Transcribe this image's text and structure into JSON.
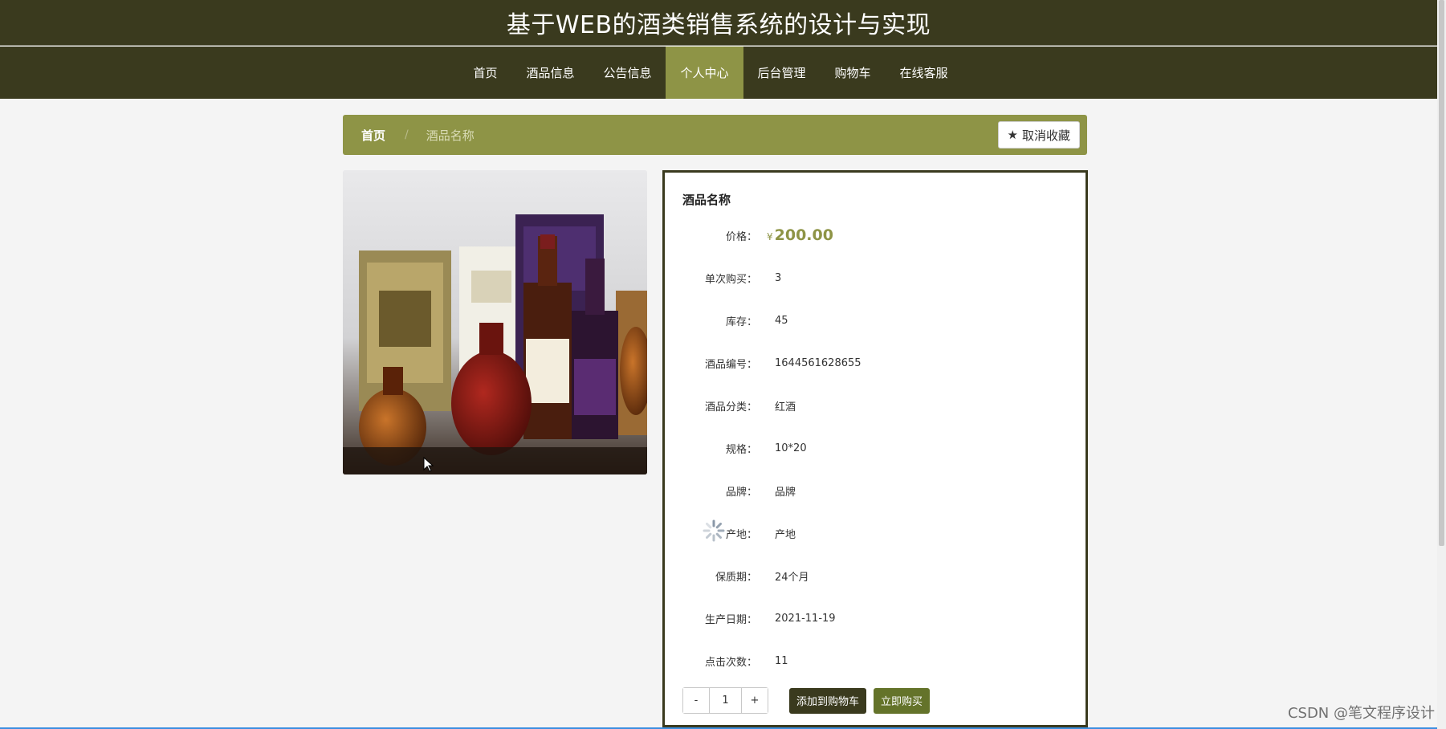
{
  "header": {
    "title": "基于WEB的酒类销售系统的设计与实现"
  },
  "nav": {
    "items": [
      {
        "label": "首页",
        "active": false
      },
      {
        "label": "酒品信息",
        "active": false
      },
      {
        "label": "公告信息",
        "active": false
      },
      {
        "label": "个人中心",
        "active": true
      },
      {
        "label": "后台管理",
        "active": false
      },
      {
        "label": "购物车",
        "active": false
      },
      {
        "label": "在线客服",
        "active": false
      }
    ]
  },
  "breadcrumb": {
    "home": "首页",
    "separator": "/",
    "current": "酒品名称"
  },
  "favorite_button": {
    "icon": "star-icon",
    "label": "取消收藏"
  },
  "product": {
    "name": "酒品名称",
    "price_label": "价格：",
    "currency": "¥",
    "price": "200.00",
    "fields": [
      {
        "label": "单次购买：",
        "value": "3"
      },
      {
        "label": "库存：",
        "value": "45"
      },
      {
        "label": "酒品编号：",
        "value": "1644561628655"
      },
      {
        "label": "酒品分类：",
        "value": "红酒"
      },
      {
        "label": "规格：",
        "value": "10*20"
      },
      {
        "label": "品牌：",
        "value": "品牌"
      },
      {
        "label": "产地：",
        "value": "产地"
      },
      {
        "label": "保质期：",
        "value": "24个月"
      },
      {
        "label": "生产日期：",
        "value": "2021-11-19"
      },
      {
        "label": "点击次数：",
        "value": "11"
      }
    ]
  },
  "quantity": {
    "minus": "-",
    "value": "1",
    "plus": "+"
  },
  "buttons": {
    "add_to_cart": "添加到购物车",
    "buy_now": "立即购买"
  },
  "watermark": "CSDN @笔文程序设计",
  "colors": {
    "header_bg": "#3a3a1e",
    "accent": "#8e9446",
    "buy": "#64732a"
  }
}
